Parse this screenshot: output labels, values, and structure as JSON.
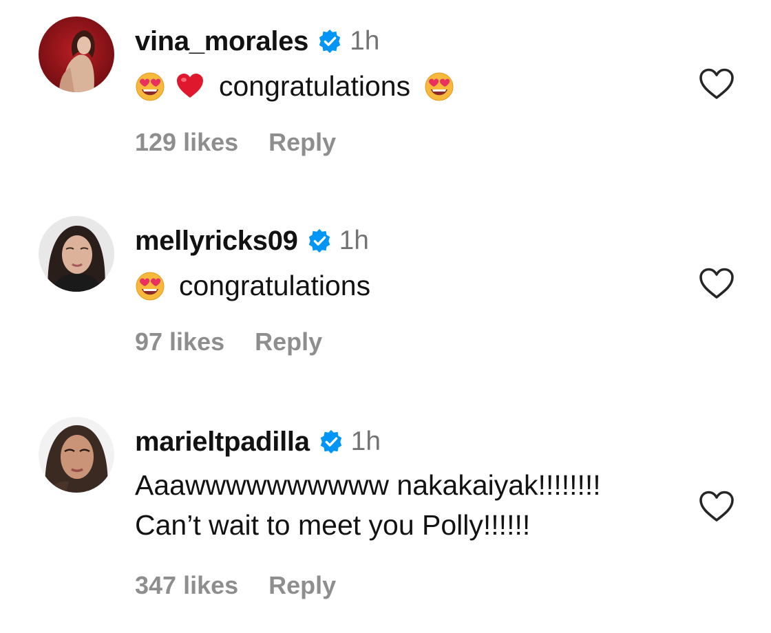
{
  "comments": [
    {
      "username": "vina_morales",
      "time": "1h",
      "text_lines": [
        "congratulations"
      ],
      "likes": "129 likes",
      "reply_label": "Reply",
      "emojis": [
        "heart-eyes-emoji",
        "red-heart-emoji",
        "heart-eyes-emoji"
      ]
    },
    {
      "username": "mellyricks09",
      "time": "1h",
      "text_lines": [
        "congratulations"
      ],
      "likes": "97 likes",
      "reply_label": "Reply",
      "emojis": [
        "heart-eyes-emoji"
      ]
    },
    {
      "username": "marieltpadilla",
      "time": "1h",
      "text_lines": [
        "Aaawwwwwwwwww nakakaiyak!!!!!!!!",
        "Can’t wait to meet you Polly!!!!!!"
      ],
      "likes": "347 likes",
      "reply_label": "Reply",
      "emojis": []
    }
  ],
  "icons": {
    "verified": "verified-badge-icon",
    "like": "heart-outline-icon"
  },
  "colors": {
    "verified_blue": "#0095f6",
    "muted_text": "#8e8e8e",
    "time_text": "#737373",
    "primary_text": "#121212"
  }
}
